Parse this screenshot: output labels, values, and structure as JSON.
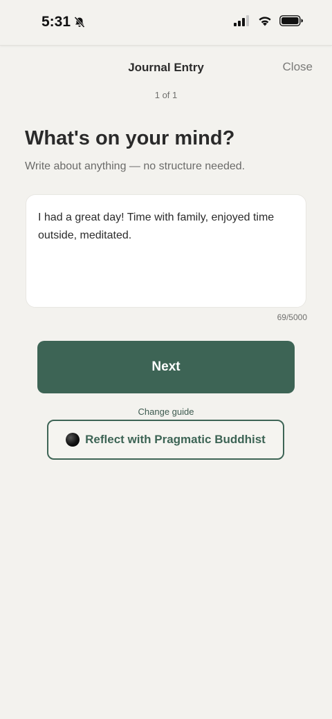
{
  "status_bar": {
    "time": "5:31",
    "icons": [
      "bell-slash-icon",
      "cellular-signal-icon",
      "wifi-icon",
      "battery-icon"
    ]
  },
  "header": {
    "title": "Journal Entry",
    "close_label": "Close",
    "page_indicator": "1 of 1"
  },
  "prompt": {
    "heading": "What's on your mind?",
    "subheading": "Write about anything — no structure needed."
  },
  "entry": {
    "text": "I had a great day! Time with family, enjoyed time outside, meditated.",
    "char_count": "69/5000"
  },
  "actions": {
    "next_label": "Next",
    "change_guide_label": "Change guide",
    "guide_button_label": "Reflect with Pragmatic Buddhist"
  },
  "colors": {
    "background": "#f3f2ee",
    "accent": "#3d6455",
    "card": "#ffffff"
  }
}
